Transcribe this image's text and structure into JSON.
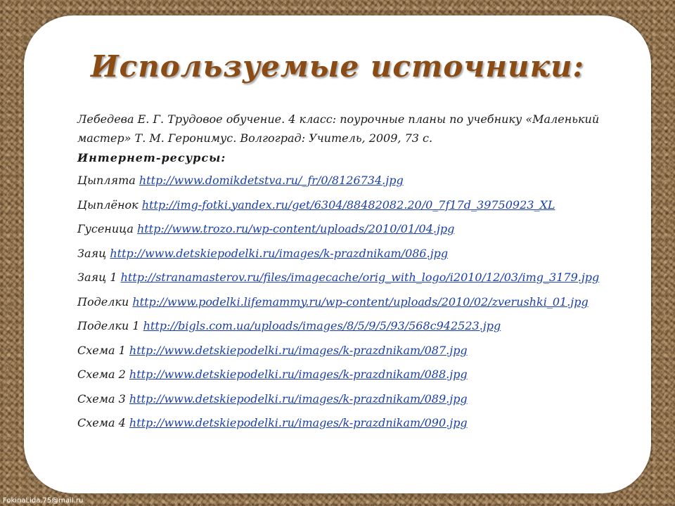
{
  "slide": {
    "title": "Используемые источники:",
    "reference": "Лебедева Е. Г. Трудовое обучение. 4 класс: поурочные планы по учебнику «Маленький мастер» Т. М. Геронимус. Волгоград: Учитель, 2009, 73 с.",
    "subheading": "Интернет-ресурсы:",
    "resources": [
      {
        "label": "Цыплята ",
        "url": "http://www.domikdetstva.ru/_fr/0/8126734.jpg"
      },
      {
        "label": "Цыплёнок ",
        "url": "http://img-fotki.yandex.ru/get/6304/88482082.20/0_7f17d_39750923_XL"
      },
      {
        "label": "Гусеница ",
        "url": "http://www.trozo.ru/wp-content/uploads/2010/01/04.jpg"
      },
      {
        "label": "Заяц ",
        "url": "http://www.detskiepodelki.ru/images/k-prazdnikam/086.jpg"
      },
      {
        "label": "Заяц 1 ",
        "url": "http://stranamasterov.ru/files/imagecache/orig_with_logo/i2010/12/03/img_3179.jpg"
      },
      {
        "label": "Поделки ",
        "url": "http://www.podelki.lifemammy.ru/wp-content/uploads/2010/02/zverushki_01.jpg"
      },
      {
        "label": "Поделки 1 ",
        "url": "http://bigls.com.ua/uploads/images/8/5/9/5/93/568c942523.jpg"
      },
      {
        "label": "Схема 1 ",
        "url": "http://www.detskiepodelki.ru/images/k-prazdnikam/087.jpg"
      },
      {
        "label": "Схема 2 ",
        "url": "http://www.detskiepodelki.ru/images/k-prazdnikam/088.jpg"
      },
      {
        "label": "Схема 3 ",
        "url": "http://www.detskiepodelki.ru/images/k-prazdnikam/089.jpg"
      },
      {
        "label": "Схема 4 ",
        "url": "http://www.detskiepodelki.ru/images/k-prazdnikam/090.jpg"
      }
    ],
    "watermark": "FokinaLida.75@mail.ru"
  },
  "colors": {
    "title": "#8a4b14",
    "link": "#1a3fa6",
    "panel": "#ffffff",
    "background": "#9a7b55"
  }
}
